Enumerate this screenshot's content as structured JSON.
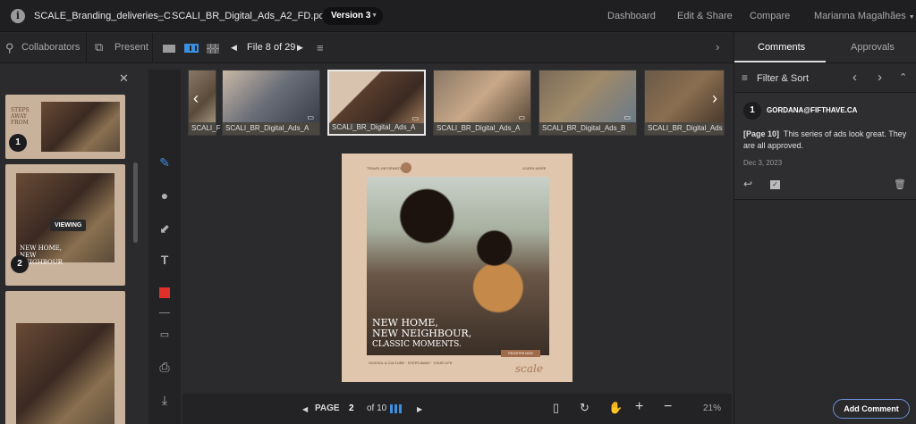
{
  "topbar": {
    "info_icon": "info-icon",
    "project": "SCALE_Branding_deliveries_C",
    "separator": "–",
    "file": "SCALI_BR_Digital_Ads_A2_FD.pdf",
    "version": "Version 3",
    "nav": [
      "Dashboard",
      "Edit & Share",
      "Compare"
    ],
    "user": "Marianna Magalhães"
  },
  "secbar": {
    "collaborators": "Collaborators",
    "present": "Present",
    "file_counter": "File 8 of 29"
  },
  "thumbs_strip": [
    {
      "label": "SCALI_F"
    },
    {
      "label": "SCALI_BR_Digital_Ads_A"
    },
    {
      "label": "SCALI_BR_Digital_Ads_A"
    },
    {
      "label": "SCALI_BR_Digital_Ads_A"
    },
    {
      "label": "SCALI_BR_Digital_Ads_B"
    },
    {
      "label": "SCALI_BR_Digital_Ads"
    }
  ],
  "left_pages": [
    {
      "num": "1",
      "text": "STEPS AWAY FROM"
    },
    {
      "num": "2",
      "badge": "VIEWING",
      "text": "NEW HOME, NEW NEIGHBOUR"
    }
  ],
  "document": {
    "header_left": "TRAVEL INFORMATION",
    "header_right": "LEARN MORE",
    "headline": [
      "NEW HOME,",
      "NEW NEIGHBOUR,",
      "CLASSIC MOMENTS."
    ],
    "cta": "REGISTER NOW",
    "footer": "SCHOOL & CULTURE · STEPS AWAY · YOUR LIFE",
    "brand": "scale"
  },
  "bottombar": {
    "page_label": "PAGE",
    "page_value": "2",
    "of_label": "of 10",
    "zoom": "21%"
  },
  "rightpanel": {
    "tabs": [
      "Comments",
      "Approvals"
    ],
    "filter_label": "Filter & Sort",
    "comment": {
      "num": "1",
      "author": "GORDANA@FIFTHAVE.CA",
      "page_ref": "[Page 10]",
      "text": "This series of ads look great.  They are all approved.",
      "date": "Dec 3, 2023"
    },
    "add_comment": "Add Comment"
  },
  "colors": {
    "accent": "#6a8fd8",
    "tool_red": "#e0302a",
    "tool_blue": "#3a8fe0"
  }
}
